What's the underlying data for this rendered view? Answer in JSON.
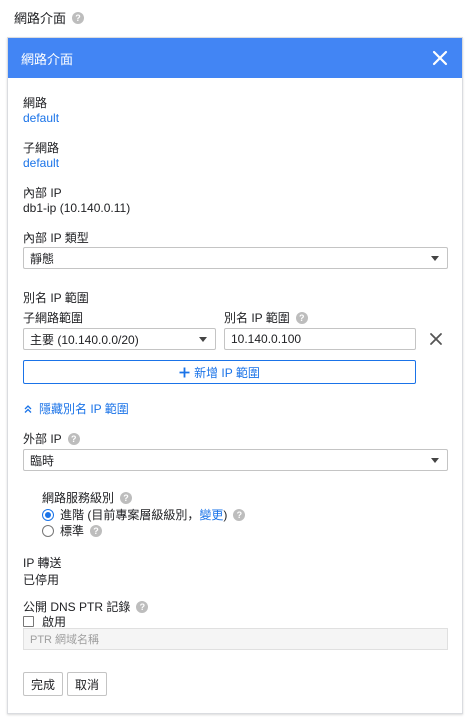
{
  "page_title": "網路介面",
  "panel": {
    "title": "網路介面",
    "network_label": "網路",
    "network_value": "default",
    "subnet_label": "子網路",
    "subnet_value": "default",
    "internal_ip_label": "內部 IP",
    "internal_ip_value": "db1-ip (10.140.0.11)",
    "internal_ip_type_label": "內部 IP 類型",
    "internal_ip_type_value": "靜態",
    "alias_section_label": "別名 IP 範圍",
    "alias_subnet_range_label": "子網路範圍",
    "alias_subnet_range_value": "主要 (10.140.0.0/20)",
    "alias_ip_range_label": "別名 IP 範圍",
    "alias_ip_range_value": "10.140.0.100",
    "add_alias_label": "新增 IP 範圍",
    "hide_alias_label": "隱藏別名 IP 範圍",
    "external_ip_label": "外部 IP",
    "external_ip_value": "臨時",
    "tier_label": "網路服務級別",
    "tier_premium_prefix": "進階 (目前專案層級級別，",
    "tier_premium_change": "變更",
    "tier_premium_suffix": ")",
    "tier_standard": "標準",
    "ip_forward_label": "IP 轉送",
    "ip_forward_value": "已停用",
    "dns_ptr_label": "公開 DNS PTR 記錄",
    "dns_enable_label": "啟用",
    "ptr_placeholder": "PTR 網域名稱",
    "done_label": "完成",
    "cancel_label": "取消"
  },
  "colors": {
    "header_bg": "#4285f4",
    "link": "#1a73e8"
  }
}
